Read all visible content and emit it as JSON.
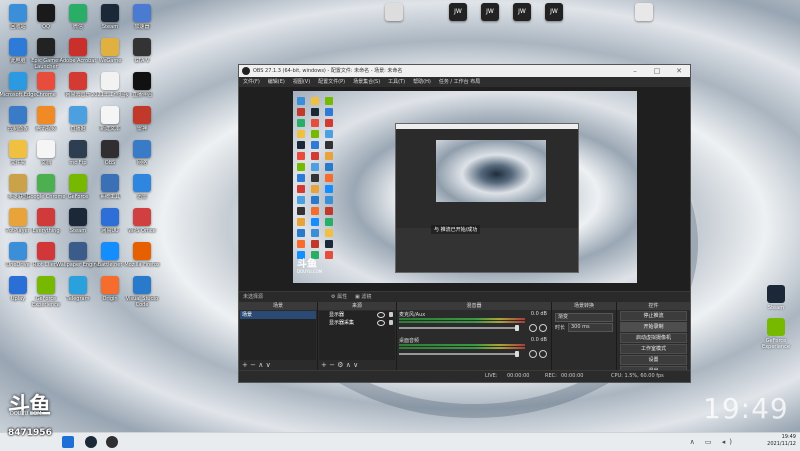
{
  "desktop": {
    "left_icons": [
      {
        "label": "回收站",
        "color": "#3a8fd8"
      },
      {
        "label": "QQ",
        "color": "#1a1a1a"
      },
      {
        "label": "微信",
        "color": "#2aae67"
      },
      {
        "label": "Steam",
        "color": "#1b2838"
      },
      {
        "label": "加速器",
        "color": "#4a7bd0"
      },
      {
        "label": "此电脑",
        "color": "#2d7bd6"
      },
      {
        "label": "Epic Games Launcher",
        "color": "#222"
      },
      {
        "label": "Adobe Acrobat",
        "color": "#c9302c"
      },
      {
        "label": "WeGame",
        "color": "#e0b040"
      },
      {
        "label": "GTA V",
        "color": "#333"
      },
      {
        "label": "Microsoft Edge",
        "color": "#2b9ae0"
      },
      {
        "label": "Chrome",
        "color": "#e74c3c"
      },
      {
        "label": "网易云音乐",
        "color": "#d33a31"
      },
      {
        "label": "2021年工作汇报",
        "color": "#f2f2f2"
      },
      {
        "label": "直播伴侣",
        "color": "#111"
      },
      {
        "label": "控制面板",
        "color": "#3a7bc8"
      },
      {
        "label": "腾讯视频",
        "color": "#f08a24"
      },
      {
        "label": "直播姬",
        "color": "#4ca0e0"
      },
      {
        "label": "新建文本",
        "color": "#f5f5f5"
      },
      {
        "label": "雷神",
        "color": "#c0392b"
      },
      {
        "label": "文件夹",
        "color": "#f0c040"
      },
      {
        "label": "文档",
        "color": "#f5f5f5"
      },
      {
        "label": "mc Ftp",
        "color": "#2c3e50"
      },
      {
        "label": "OBS",
        "color": "#302e31"
      },
      {
        "label": "网络",
        "color": "#3a7bc8"
      },
      {
        "label": "英雄联盟",
        "color": "#c9a24a"
      },
      {
        "label": "Google Chrome",
        "color": "#4caf50"
      },
      {
        "label": "GeForce",
        "color": "#76b900"
      },
      {
        "label": "系统工具",
        "color": "#3b6fb6"
      },
      {
        "label": "迅雷",
        "color": "#2e86de"
      },
      {
        "label": "PotPlayer",
        "color": "#e8a33a"
      },
      {
        "label": "Everything",
        "color": "#d03a3a"
      },
      {
        "label": "Steam",
        "color": "#1b2838"
      },
      {
        "label": "网易UU",
        "color": "#2d6fd6"
      },
      {
        "label": "WPS Office",
        "color": "#d04040"
      },
      {
        "label": "OneDrive",
        "color": "#3a8fd8"
      },
      {
        "label": "Riot Client",
        "color": "#d13639"
      },
      {
        "label": "Wallpaper Engine",
        "color": "#3b5b8a"
      },
      {
        "label": "Battle.net",
        "color": "#148eff"
      },
      {
        "label": "Mozilla Firefox",
        "color": "#e66000"
      },
      {
        "label": "Uplay",
        "color": "#2a6fd6"
      },
      {
        "label": "GeForce Experience",
        "color": "#76b900"
      },
      {
        "label": "Telegram",
        "color": "#2aa0dc"
      },
      {
        "label": "Origin",
        "color": "#f56c2d"
      },
      {
        "label": "Visual Studio Code",
        "color": "#2a7acc"
      }
    ],
    "top_icons": [
      {
        "label": "",
        "color": "#ddd"
      },
      {
        "label": "JW",
        "color": "#222"
      },
      {
        "label": "JW",
        "color": "#222"
      },
      {
        "label": "JW",
        "color": "#222"
      },
      {
        "label": "JW",
        "color": "#222"
      },
      {
        "label": "",
        "color": "#e8e8e8"
      }
    ],
    "right_icons": [
      {
        "label": "Steam",
        "color": "#1b2838"
      },
      {
        "label": "GeForce Experience",
        "color": "#76b900"
      }
    ],
    "watermark_brand": "斗鱼",
    "watermark_sub": "DOUYU.COM",
    "room_number": "8471956",
    "clock_overlay": "19:49"
  },
  "obs": {
    "title": "OBS 27.1.3 (64-bit, windows) - 配置文件: 未命名 - 场景: 未命名",
    "menu": [
      "文件(F)",
      "编辑(E)",
      "视图(V)",
      "配置文件(P)",
      "场景集合(S)",
      "工具(T)",
      "帮助(H)",
      "任务 / 工作台 布局"
    ],
    "inner_toast": "与 推流已开始/成功",
    "source_bar": {
      "label": "未选择源",
      "props_btn": "属性",
      "filters_btn": "滤镜"
    },
    "docks": {
      "scenes": {
        "title": "场景",
        "items": [
          "场景"
        ]
      },
      "sources": {
        "title": "来源",
        "items": [
          "显示器",
          "显示器采集"
        ]
      },
      "mixer": {
        "title": "混音器",
        "tracks": [
          {
            "name": "麦克风/Aux",
            "db": "0.0 dB"
          },
          {
            "name": "桌面音频",
            "db": "0.0 dB"
          }
        ]
      },
      "transitions": {
        "title": "场景转换",
        "type": "渐变",
        "duration_label": "时长",
        "duration": "300 ms"
      },
      "controls": {
        "title": "控件",
        "buttons": [
          {
            "label": "停止推流",
            "active": false
          },
          {
            "label": "开始录制",
            "active": true
          },
          {
            "label": "启动虚拟摄像机",
            "active": false
          },
          {
            "label": "工作室模式",
            "active": false
          },
          {
            "label": "设置",
            "active": false
          },
          {
            "label": "退出",
            "active": false
          }
        ]
      }
    },
    "status": {
      "live_label": "LIVE:",
      "live_time": "00:00:00",
      "rec_label": "REC:",
      "rec_time": "00:00:00",
      "cpu": "CPU: 1.5%, 60.00 fps"
    }
  },
  "taskbar": {
    "time": "19:49",
    "date": "2021/11/12"
  }
}
